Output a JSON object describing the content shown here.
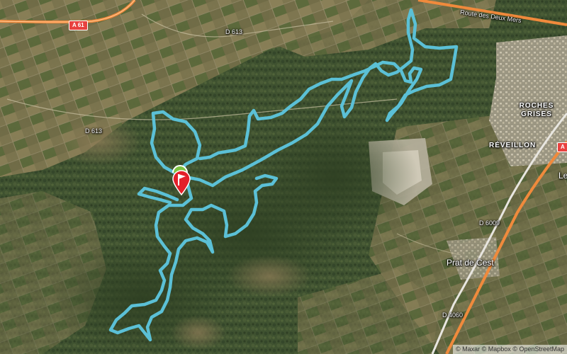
{
  "map": {
    "roads": {
      "a61": "A 61",
      "deux_mers": "Route des Deux Mers",
      "d613_top": "D 613",
      "d613_left": "D 613",
      "d6009": "D 6009",
      "d4060": "D 4060",
      "motorway_right": "A"
    },
    "places": {
      "roches_grises": "ROCHES GRISES",
      "reveillon": "RÉVEILLON",
      "prat_de_cest": "Prat de Cest",
      "le": "Le"
    },
    "track_color": "#5bc0d6",
    "motorway_color": "#f08a3c",
    "start_marker_color": "#7dc242",
    "end_marker_color": "#e3202a"
  },
  "attribution": {
    "maxar": "© Maxar",
    "mapbox": "© Mapbox",
    "osm": "© OpenStreetMap"
  }
}
